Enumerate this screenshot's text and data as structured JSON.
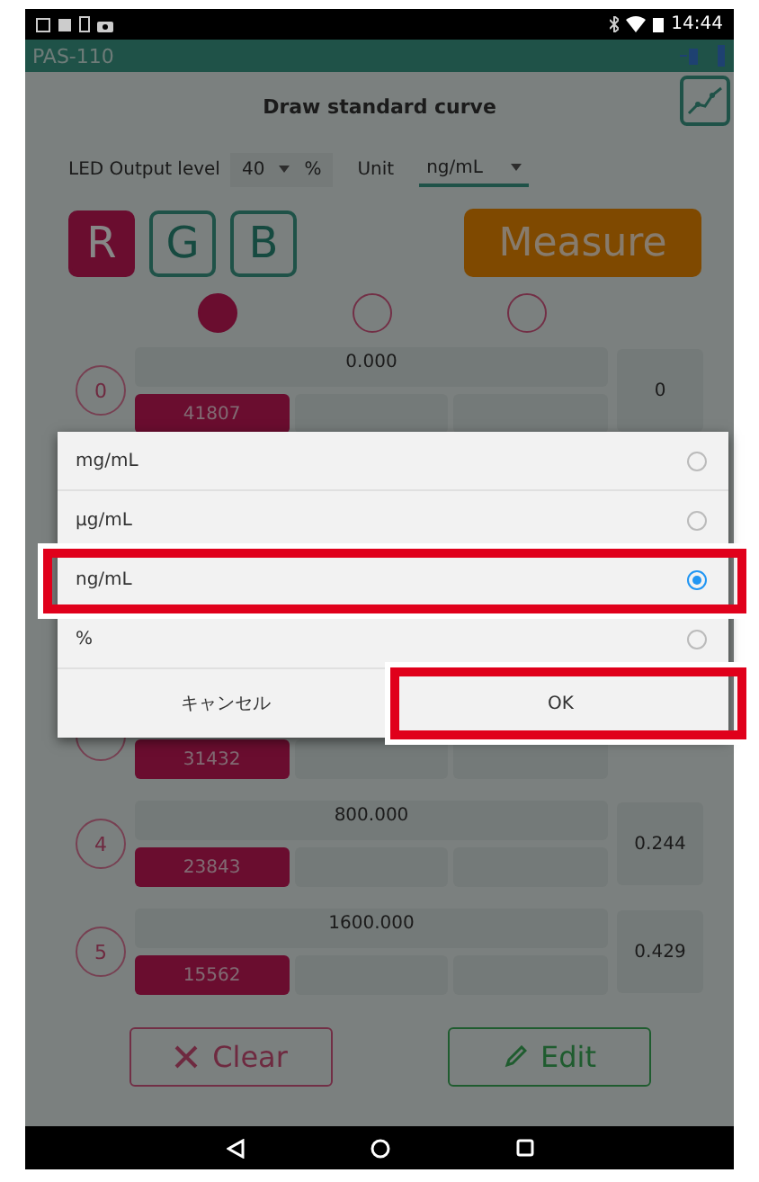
{
  "status_bar": {
    "time": "14:44"
  },
  "app_bar": {
    "title": "PAS-110"
  },
  "header": {
    "title": "Draw standard curve"
  },
  "led_output": {
    "label": "LED Output level",
    "value": "40",
    "unit": "%"
  },
  "unit_select": {
    "label": "Unit",
    "value": "ng/mL"
  },
  "channels": [
    {
      "label": "R",
      "selected": true
    },
    {
      "label": "G",
      "selected": false
    },
    {
      "label": "B",
      "selected": false
    }
  ],
  "measure_button": "Measure",
  "indicators": [
    {
      "selected": true
    },
    {
      "selected": false
    },
    {
      "selected": false
    }
  ],
  "rows": [
    {
      "number": "0",
      "concentration": "0.000",
      "reading": "41807",
      "result": "0"
    },
    {
      "reading": "31432"
    },
    {
      "number": "4",
      "concentration": "800.000",
      "reading": "23843",
      "result": "0.244"
    },
    {
      "number": "5",
      "concentration": "1600.000",
      "reading": "15562",
      "result": "0.429"
    }
  ],
  "actions": [
    {
      "kind": "clear",
      "label": "Clear"
    },
    {
      "kind": "edit",
      "label": "Edit"
    }
  ],
  "dialog": {
    "options": [
      {
        "label": "mg/mL",
        "selected": false,
        "highlighted": false
      },
      {
        "label": "µg/mL",
        "selected": false,
        "highlighted": false
      },
      {
        "label": "ng/mL",
        "selected": true,
        "highlighted": true
      },
      {
        "label": "%",
        "selected": false,
        "highlighted": false
      }
    ],
    "buttons": [
      {
        "label": "キャンセル",
        "highlighted": false
      },
      {
        "label": "OK",
        "highlighted": true
      }
    ]
  }
}
